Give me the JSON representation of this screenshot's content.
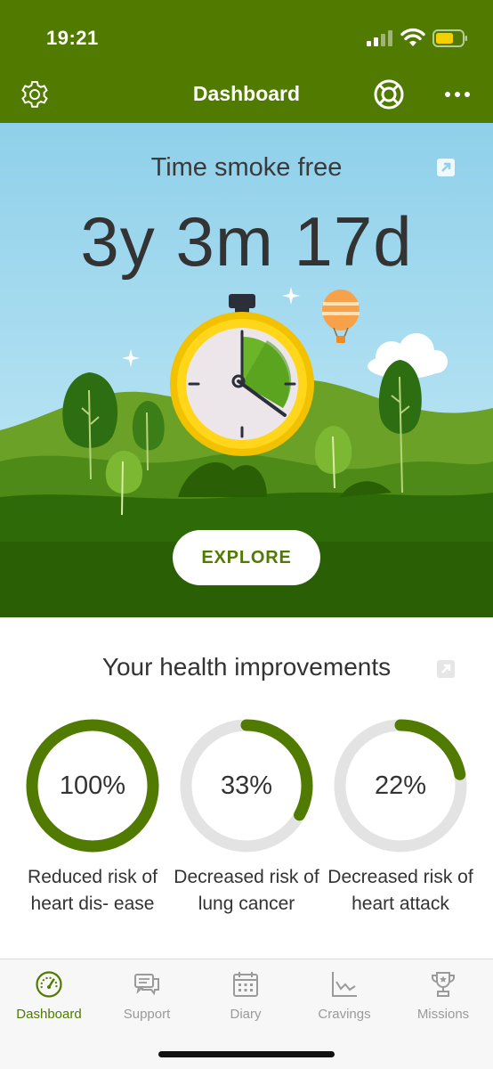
{
  "status_bar": {
    "time": "19:21"
  },
  "header": {
    "title": "Dashboard"
  },
  "hero": {
    "title": "Time smoke free",
    "counter": "3y 3m 17d",
    "explore_label": "EXPLORE"
  },
  "health": {
    "title": "Your health improvements",
    "items": [
      {
        "value_text": "100%",
        "progress": 1.0,
        "label": "Reduced risk of heart dis- ease"
      },
      {
        "value_text": "33%",
        "progress": 0.33,
        "label": "Decreased risk of lung cancer"
      },
      {
        "value_text": "22%",
        "progress": 0.22,
        "label": "Decreased risk of heart attack"
      }
    ]
  },
  "tabs": [
    {
      "label": "Dashboard",
      "icon": "speedometer-icon",
      "active": true
    },
    {
      "label": "Support",
      "icon": "chat-bubbles-icon",
      "active": false
    },
    {
      "label": "Diary",
      "icon": "calendar-icon",
      "active": false
    },
    {
      "label": "Cravings",
      "icon": "line-chart-icon",
      "active": false
    },
    {
      "label": "Missions",
      "icon": "trophy-icon",
      "active": false
    }
  ],
  "colors": {
    "brand_green": "#507a00",
    "ring_track": "#e3e3e3",
    "tab_inactive": "#9a9a9a",
    "sky": "#8fd0ea"
  }
}
